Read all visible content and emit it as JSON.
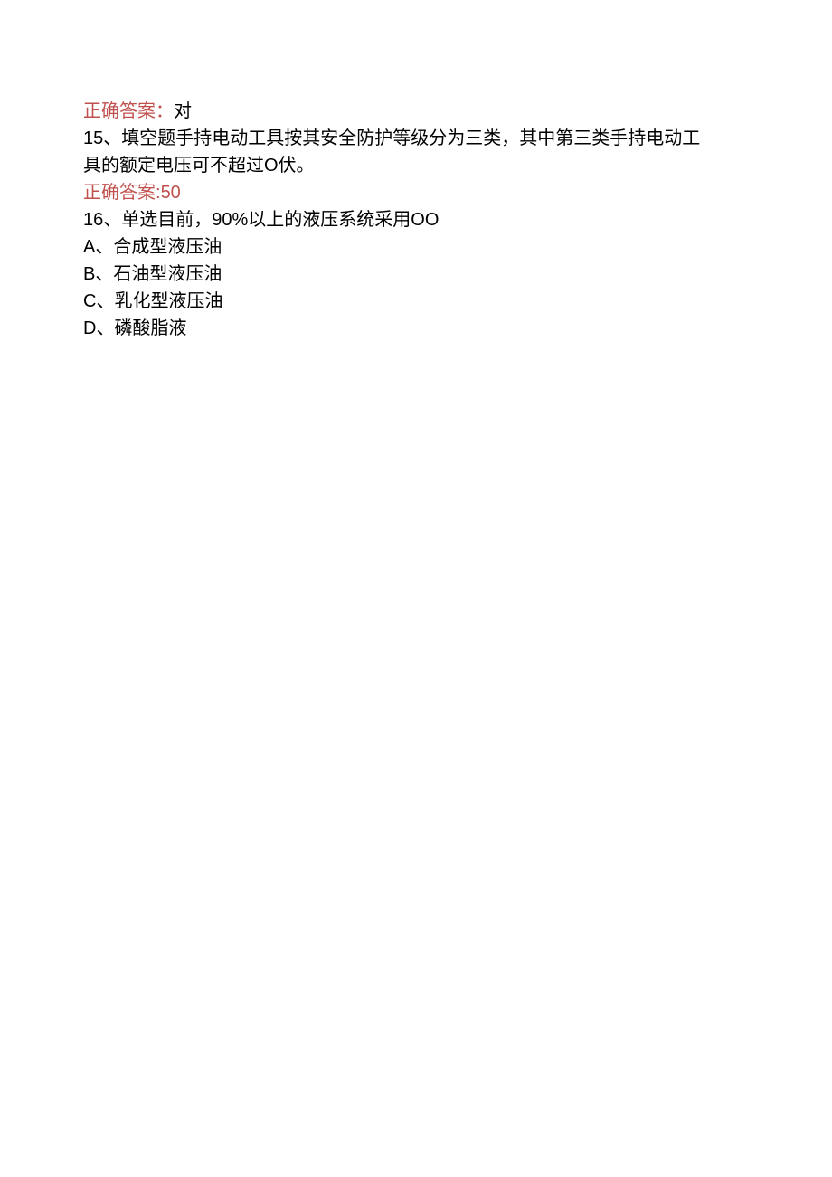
{
  "answer14": {
    "label": "正确答案：",
    "value": "对"
  },
  "q15": {
    "number": "15、",
    "type": "填空题",
    "text_line1": "手持电动工具按其安全防护等级分为三类，其中第三类手持电动工",
    "text_line2": "具的额定电压可不超过O伏。"
  },
  "answer15": {
    "label": "正确答案:",
    "value": "50"
  },
  "q16": {
    "number": "16、",
    "type": "单选",
    "text": "目前，90%以上的液压系统采用OO",
    "options": {
      "A": "A、合成型液压油",
      "B": "B、石油型液压油",
      "C": "C、乳化型液压油",
      "D": "D、磷酸脂液"
    }
  }
}
